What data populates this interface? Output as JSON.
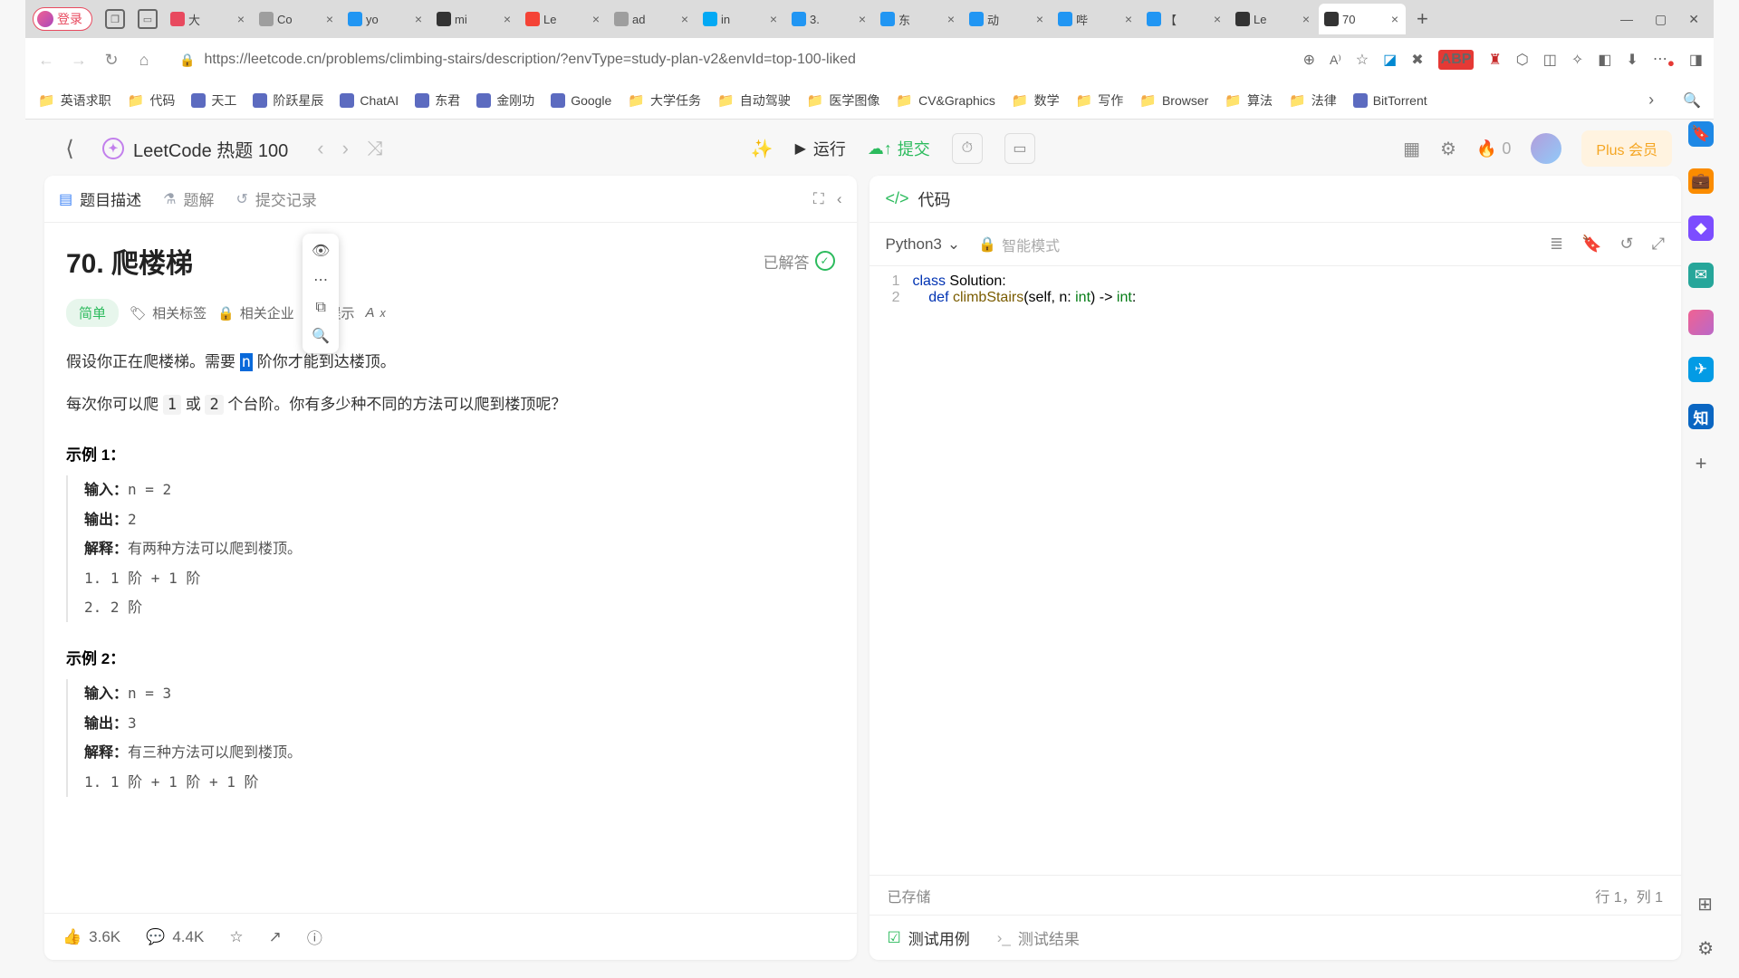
{
  "browser": {
    "login": "登录",
    "tabs": [
      {
        "title": "大",
        "favColor": "#e84a5f"
      },
      {
        "title": "Co",
        "favColor": "#9e9e9e"
      },
      {
        "title": "yo",
        "favColor": "#2196f3"
      },
      {
        "title": "mi",
        "favColor": "#333"
      },
      {
        "title": "Le",
        "favColor": "#f44336"
      },
      {
        "title": "ad",
        "favColor": "#9e9e9e"
      },
      {
        "title": "in",
        "favColor": "#03a9f4"
      },
      {
        "title": "3.",
        "favColor": "#2196f3"
      },
      {
        "title": "东",
        "favColor": "#2196f3"
      },
      {
        "title": "动",
        "favColor": "#2196f3"
      },
      {
        "title": "哔",
        "favColor": "#2196f3"
      },
      {
        "title": "【",
        "favColor": "#2196f3"
      },
      {
        "title": "Le",
        "favColor": "#333"
      },
      {
        "title": "70",
        "favColor": "#333",
        "active": true
      }
    ],
    "url": "https://leetcode.cn/problems/climbing-stairs/description/?envType=study-plan-v2&envId=top-100-liked",
    "bookmarks": [
      "英语求职",
      "代码",
      "天工",
      "阶跃星辰",
      "ChatAI",
      "东君",
      "金刚功",
      "Google",
      "大学任务",
      "自动驾驶",
      "医学图像",
      "CV&Graphics",
      "数学",
      "写作",
      "Browser",
      "算法",
      "法律",
      "BitTorrent"
    ]
  },
  "header": {
    "studyPlan": "LeetCode 热题 100",
    "run": "运行",
    "submit": "提交",
    "fireCount": "0",
    "plus": "Plus 会员"
  },
  "leftTabs": {
    "description": "题目描述",
    "solutions": "题解",
    "submissions": "提交记录"
  },
  "problem": {
    "title": "70. 爬楼梯",
    "solvedLabel": "已解答",
    "difficulty": "简单",
    "tags": "相关标签",
    "companies": "相关企业",
    "hints": "提示",
    "para1_a": "假设你正在爬楼梯。需要 ",
    "para1_sel": "n",
    "para1_b": " 阶你才能到达楼顶。",
    "para2_a": "每次你可以爬 ",
    "para2_c1": "1",
    "para2_b": " 或 ",
    "para2_c2": "2",
    "para2_c": " 个台阶。你有多少种不同的方法可以爬到楼顶呢？",
    "ex1_title": "示例 1：",
    "ex1_input_l": "输入：",
    "ex1_input_v": "n = 2",
    "ex1_output_l": "输出：",
    "ex1_output_v": "2",
    "ex1_expl_l": "解释：",
    "ex1_expl_v": "有两种方法可以爬到楼顶。",
    "ex1_step1": "1. 1 阶 + 1 阶",
    "ex1_step2": "2. 2 阶",
    "ex2_title": "示例 2：",
    "ex2_input_l": "输入：",
    "ex2_input_v": "n = 3",
    "ex2_output_l": "输出：",
    "ex2_output_v": "3",
    "ex2_expl_l": "解释：",
    "ex2_expl_v": "有三种方法可以爬到楼顶。",
    "ex2_step1": "1. 1 阶 + 1 阶 + 1 阶"
  },
  "footer": {
    "likes": "3.6K",
    "comments": "4.4K"
  },
  "code": {
    "paneLabel": "代码",
    "language": "Python3",
    "smartMode": "智能模式",
    "line1_kw": "class",
    "line1_cls": " Solution",
    "line1_rest": ":",
    "line2_indent": "    ",
    "line2_kw": "def",
    "line2_fn": " climbStairs",
    "line2_p1": "(self, n: ",
    "line2_t1": "int",
    "line2_p2": ") -> ",
    "line2_t2": "int",
    "line2_rest": ":",
    "saved": "已存储",
    "cursor": "行 1，列 1",
    "testCases": "测试用例",
    "testResults": "测试结果"
  }
}
